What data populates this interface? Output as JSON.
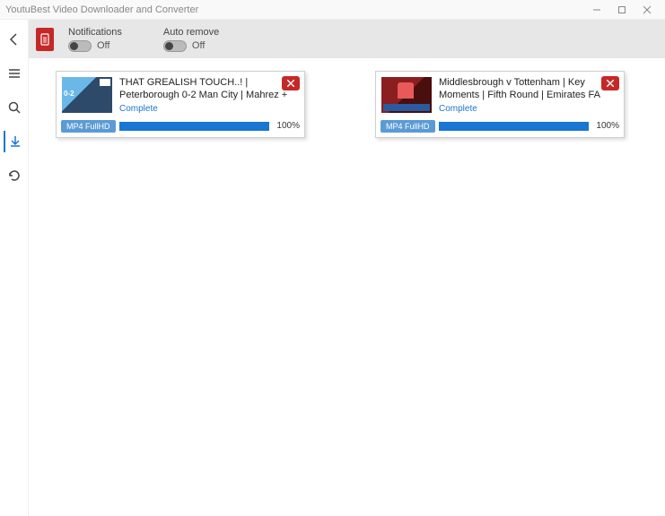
{
  "app_title": "YoutuBest Video Downloader and Converter",
  "toolbar": {
    "notifications": {
      "label": "Notifications",
      "state": "Off"
    },
    "auto_remove": {
      "label": "Auto remove",
      "state": "Off"
    }
  },
  "downloads": [
    {
      "title": "THAT GREALISH TOUCH..! | Peterborough 0-2 Man City | Mahrez +",
      "status": "Complete",
      "format": "MP4 FullHD",
      "progress_pct": "100%"
    },
    {
      "title": "Middlesbrough v Tottenham | Key Moments | Fifth Round | Emirates FA",
      "status": "Complete",
      "format": "MP4 FullHD",
      "progress_pct": "100%"
    }
  ]
}
